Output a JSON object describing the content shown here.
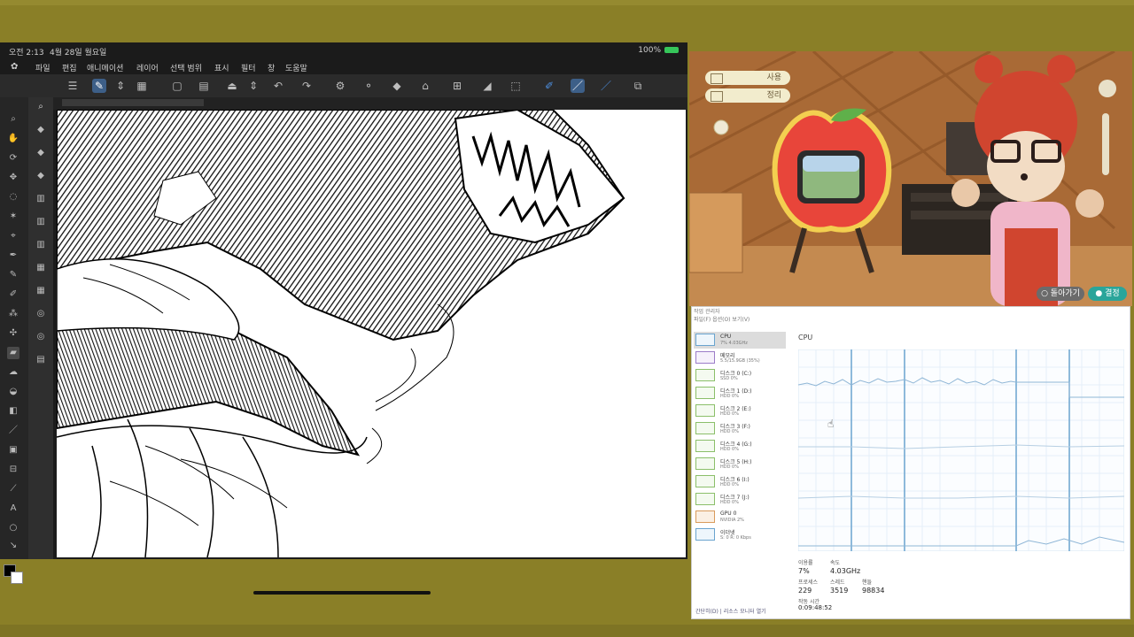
{
  "ipad": {
    "status_time": "오전 2:13",
    "status_date": "4월 28일 월요일",
    "battery": "100%",
    "menu": [
      "파일",
      "편집",
      "애니메이션",
      "레이어",
      "선택 범위",
      "표시",
      "필터",
      "창",
      "도움말"
    ]
  },
  "game": {
    "hud_items": [
      "사용",
      "정리"
    ],
    "buttons": [
      "○ 돌아가기",
      "● 결정"
    ]
  },
  "taskman": {
    "title_bar": "작업 관리자",
    "menu": "파일(F)  옵션(O)  보기(V)",
    "cpu_title": "CPU",
    "rows": [
      {
        "l1": "CPU",
        "l2": "7% 4.03GHz",
        "color": "blue",
        "selected": true
      },
      {
        "l1": "메모리",
        "l2": "5.5/15.9GB (35%)",
        "color": "purple",
        "selected": false
      },
      {
        "l1": "디스크 0 (C:)",
        "l2": "SSD 0%",
        "color": "green",
        "selected": false
      },
      {
        "l1": "디스크 1 (D:)",
        "l2": "HDD 0%",
        "color": "green",
        "selected": false
      },
      {
        "l1": "디스크 2 (E:)",
        "l2": "HDD 0%",
        "color": "green",
        "selected": false
      },
      {
        "l1": "디스크 3 (F:)",
        "l2": "HDD 0%",
        "color": "green",
        "selected": false
      },
      {
        "l1": "디스크 4 (G:)",
        "l2": "HDD 0%",
        "color": "green",
        "selected": false
      },
      {
        "l1": "디스크 5 (H:)",
        "l2": "HDD 0%",
        "color": "green",
        "selected": false
      },
      {
        "l1": "디스크 6 (I:)",
        "l2": "HDD 0%",
        "color": "green",
        "selected": false
      },
      {
        "l1": "디스크 7 (J:)",
        "l2": "HDD 0%",
        "color": "green",
        "selected": false
      },
      {
        "l1": "GPU 0",
        "l2": "NVIDIA 2%",
        "color": "orange",
        "selected": false
      },
      {
        "l1": "이더넷",
        "l2": "S: 0 R: 0 Kbps",
        "color": "blue",
        "selected": false
      }
    ],
    "stats": [
      "이용률",
      "속도",
      "7%",
      "4.03GHz",
      "프로세스",
      "스레드",
      "핸들",
      "229",
      "3519",
      "98834",
      "작동 시간",
      "0:09:48:52"
    ],
    "footer": "간단히(D) | 리소스 모니터 열기"
  }
}
